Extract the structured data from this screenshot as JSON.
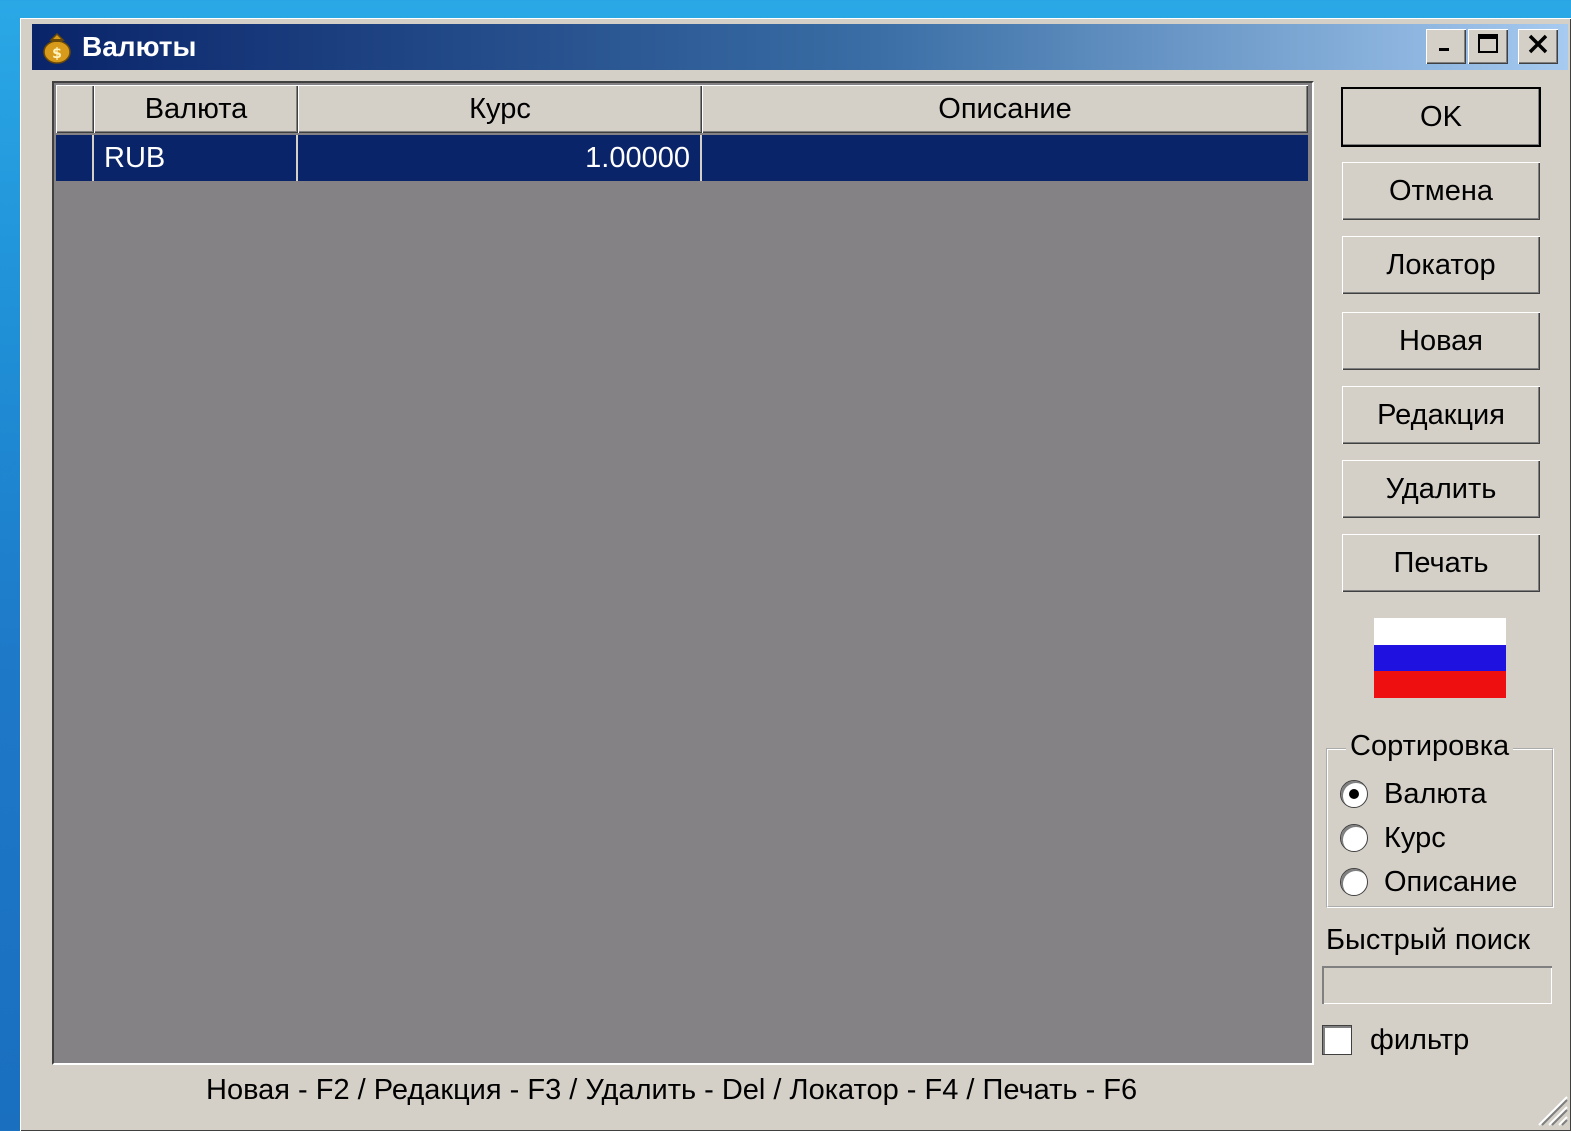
{
  "window": {
    "title": "Валюты",
    "minimize_glyph": "_",
    "maximize_glyph": "□",
    "close_glyph": "✕"
  },
  "grid": {
    "columns": [
      "Валюта",
      "Курс",
      "Описание"
    ],
    "rows": [
      {
        "currency": "RUB",
        "rate": "1.00000",
        "description": "",
        "selected": true
      }
    ]
  },
  "buttons": {
    "ok": "OK",
    "cancel": "Отмена",
    "locator": "Локатор",
    "new": "Новая",
    "edit": "Редакция",
    "delete": "Удалить",
    "print": "Печать"
  },
  "flag": {
    "icon": "russian-flag",
    "colors": [
      "#ffffff",
      "#1f12e0",
      "#ee1010"
    ]
  },
  "sort": {
    "legend": "Сортировка",
    "options": [
      "Валюта",
      "Курс",
      "Описание"
    ],
    "selected": "Валюта"
  },
  "quick_search": {
    "label": "Быстрый поиск",
    "value": ""
  },
  "filter": {
    "label": "фильтр",
    "checked": false
  },
  "status_hint": "Новая - F2 / Редакция - F3 / Удалить - Del / Локатор - F4 / Печать - F6",
  "colors": {
    "selection": "#0a246a",
    "grid_background": "#858285",
    "face": "#d4d0c8"
  }
}
